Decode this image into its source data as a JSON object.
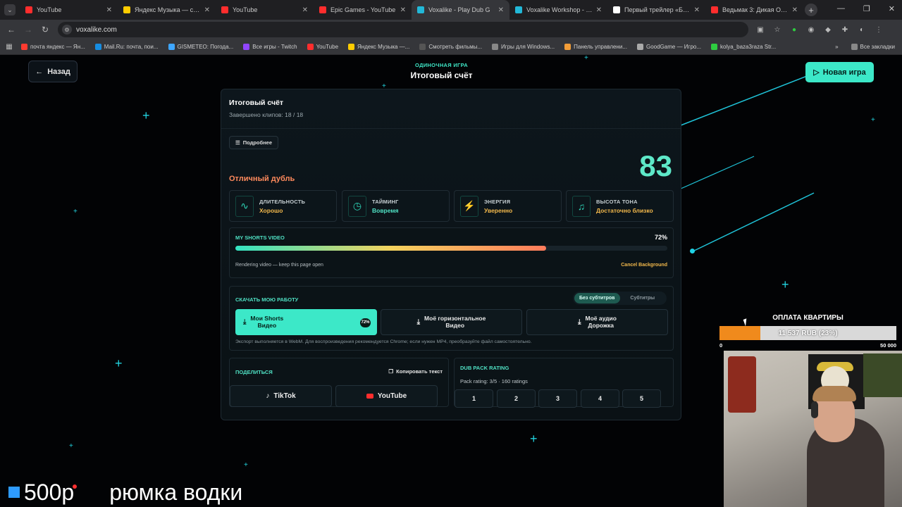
{
  "browser": {
    "tabs": [
      {
        "title": "YouTube",
        "color": "#ff2d2d",
        "active": false
      },
      {
        "title": "Яндекс Музыка — собир",
        "color": "#ffcc00",
        "active": false
      },
      {
        "title": "YouTube",
        "color": "#ff2d2d",
        "active": false
      },
      {
        "title": "Epic Games - YouTube",
        "color": "#ff2d2d",
        "active": false
      },
      {
        "title": "Voxalike - Play Dub G",
        "color": "#22b8d8",
        "active": true
      },
      {
        "title": "Voxalike Workshop - Page",
        "color": "#22b8d8",
        "active": false
      },
      {
        "title": "Первый трейлер «Баллад",
        "color": "#ffffff",
        "active": false
      },
      {
        "title": "Ведьмак 3: Дикая Охота",
        "color": "#ff2d2d",
        "active": false
      }
    ],
    "url": "voxalike.com",
    "bookmarks": [
      {
        "label": "почта яндекс — Ян...",
        "color": "#ff3b30"
      },
      {
        "label": "Mail.Ru: почта, пои...",
        "color": "#168de2"
      },
      {
        "label": "GISMETEO: Погода...",
        "color": "#3ea6ff"
      },
      {
        "label": "Все игры - Twitch",
        "color": "#9146ff"
      },
      {
        "label": "YouTube",
        "color": "#ff2d2d"
      },
      {
        "label": "Яндекс Музыка —...",
        "color": "#ffcc00"
      },
      {
        "label": "Смотреть фильмы...",
        "color": "#555555"
      },
      {
        "label": "Игры для Windows...",
        "color": "#888888"
      },
      {
        "label": "Панель управлени...",
        "color": "#f29d38"
      },
      {
        "label": "GoodGame — Игро...",
        "color": "#aaaaaa"
      },
      {
        "label": "kolya_baza3raza Str...",
        "color": "#2ecc40"
      }
    ],
    "all_bookmarks": "Все закладки"
  },
  "header": {
    "back_label": "Назад",
    "mode": "ОДИНОЧНАЯ ИГРА",
    "title": "Итоговый счёт",
    "new_game_label": "Новая игра"
  },
  "summary": {
    "title": "Итоговый счёт",
    "clips": "Завершено клипов: 18 / 18",
    "more_label": "Подробнее",
    "grade": "Отличный дубль",
    "score": "83",
    "stats": [
      {
        "label": "ДЛИТЕЛЬНОСТЬ",
        "value": "Хорошо",
        "icon": "wave-icon"
      },
      {
        "label": "ТАЙМИНГ",
        "value": "Вовремя",
        "icon": "timing-icon"
      },
      {
        "label": "ЭНЕРГИЯ",
        "value": "Уверенно",
        "icon": "energy-icon"
      },
      {
        "label": "ВЫСОТА ТОНА",
        "value": "Достаточно близко",
        "icon": "pitch-icon"
      }
    ]
  },
  "video": {
    "title": "MY SHORTS VIDEO",
    "percent_label": "72%",
    "progress": 0.72,
    "note": "Rendering video — keep this page open",
    "cancel_label": "Cancel Background"
  },
  "download": {
    "title": "СКАЧАТЬ МОЮ РАБОТУ",
    "toggle": [
      "Без субтитров",
      "Субтитры"
    ],
    "buttons": [
      {
        "line1": "Мои Shorts",
        "line2": "Видео",
        "badge": "72%"
      },
      {
        "line1": "Моё горизонтальное",
        "line2": "Видео"
      },
      {
        "line1": "Моё аудио",
        "line2": "Дорожка"
      }
    ],
    "note": "Экспорт выполняется в WebM. Для воспроизведения рекомендуется Chrome; если нужен MP4, преобразуйте файл самостоятельно."
  },
  "share": {
    "title": "ПОДЕЛИТЬСЯ",
    "copy_label": "Копировать текст",
    "tiktok": "TikTok",
    "youtube": "YouTube"
  },
  "rating": {
    "title": "DUB PACK RATING",
    "info": "Pack rating: 3/5 · 160 ratings",
    "options": [
      "1",
      "2",
      "3",
      "4",
      "5"
    ]
  },
  "overlay": {
    "donate_title": "ОПЛАТА КВАРТИРЫ",
    "donate_amount": "11 537 RUB (23%)",
    "donate_progress": 0.23,
    "donate_min": "0",
    "donate_max": "50 000",
    "caption_price": "500р",
    "caption_text": "рюмка водки"
  }
}
